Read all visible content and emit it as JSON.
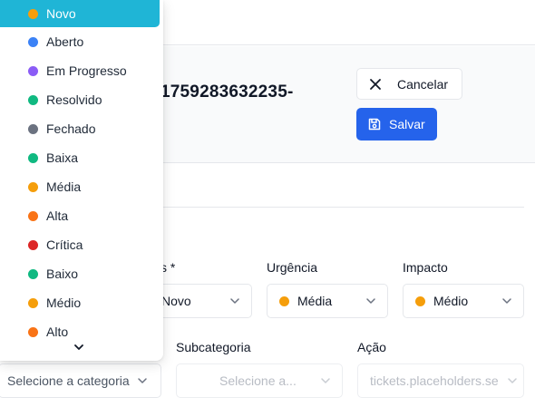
{
  "ticket": {
    "id_fragment": "1759283632235-"
  },
  "actions": {
    "cancel_label": "Cancelar",
    "save_label": "Salvar"
  },
  "fields": {
    "status": {
      "label": "s *",
      "value": "Novo"
    },
    "urgency": {
      "label": "Urgência",
      "value": "Média",
      "dot_color": "#f59e0b"
    },
    "impact": {
      "label": "Impacto",
      "value": "Médio",
      "dot_color": "#f59e0b"
    },
    "category": {
      "placeholder": "Selecione a categoria"
    },
    "subcategory": {
      "label": "Subcategoria",
      "placeholder": "Selecione a..."
    },
    "action": {
      "label": "Ação",
      "placeholder": "tickets.placeholders.se"
    }
  },
  "dropdown": {
    "options": [
      {
        "label": "Novo",
        "color": "#f59e0b",
        "selected": true
      },
      {
        "label": "Aberto",
        "color": "#3b82f6"
      },
      {
        "label": "Em Progresso",
        "color": "#8b5cf6"
      },
      {
        "label": "Resolvido",
        "color": "#10b981"
      },
      {
        "label": "Fechado",
        "color": "#6b7280"
      },
      {
        "label": "Baixa",
        "color": "#10b981"
      },
      {
        "label": "Média",
        "color": "#f59e0b"
      },
      {
        "label": "Alta",
        "color": "#f97316"
      },
      {
        "label": "Crítica",
        "color": "#dc2626"
      },
      {
        "label": "Baixo",
        "color": "#10b981"
      },
      {
        "label": "Médio",
        "color": "#f59e0b"
      },
      {
        "label": "Alto",
        "color": "#f97316"
      }
    ],
    "more_icon": "chevron-down-icon"
  }
}
